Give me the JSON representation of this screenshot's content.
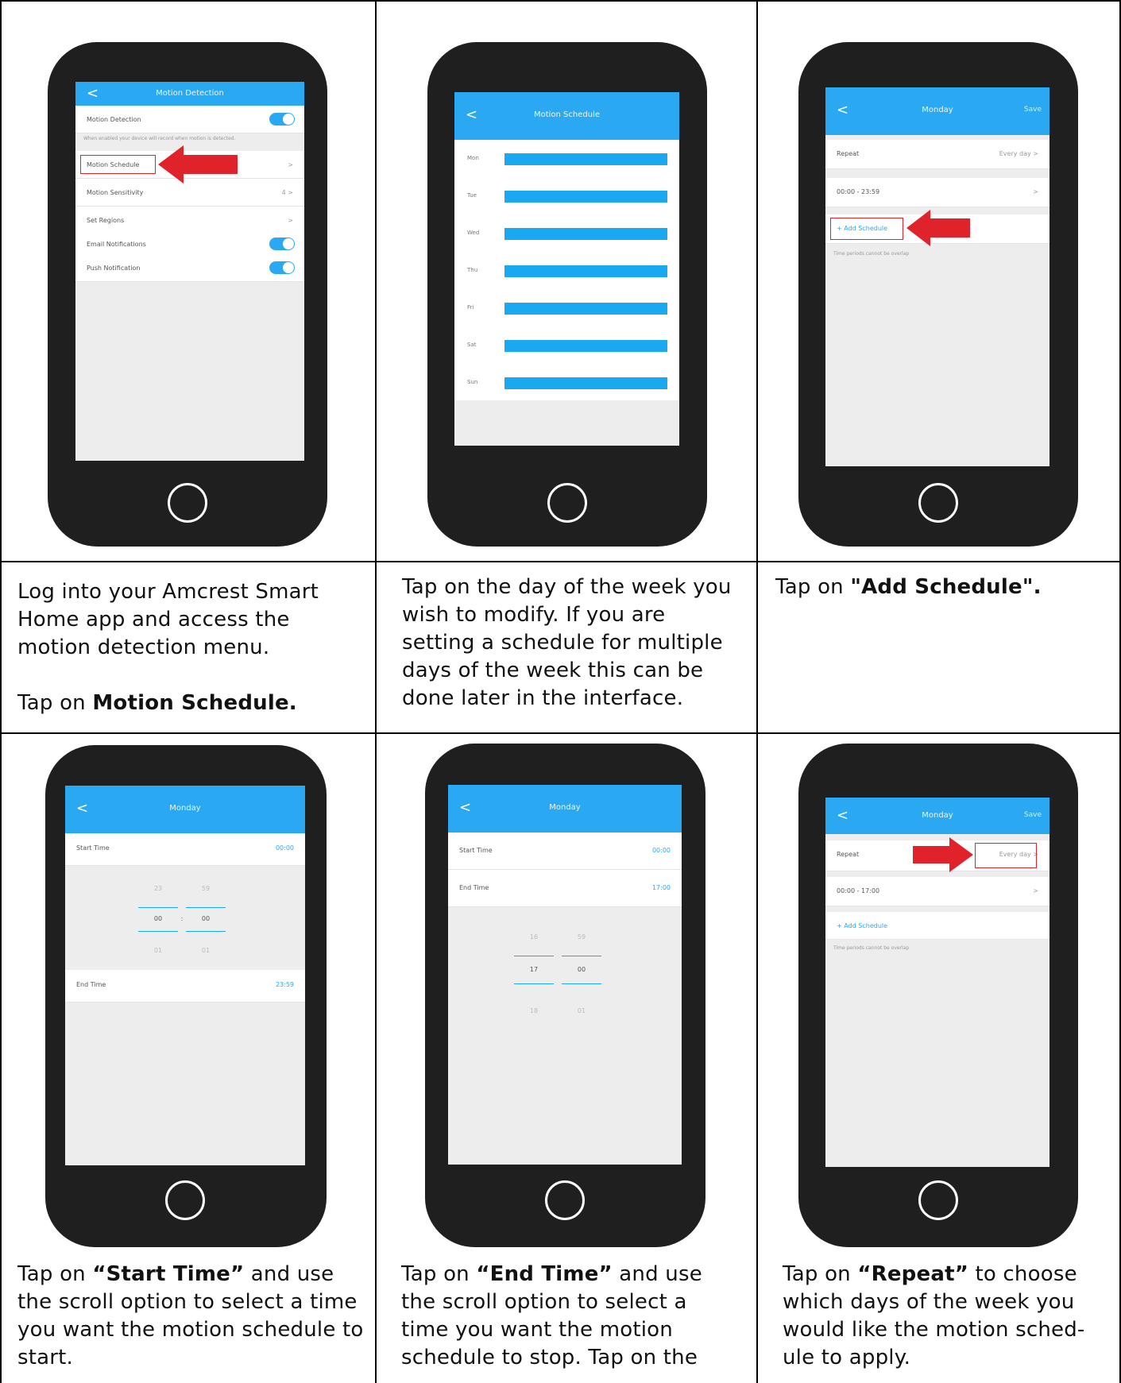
{
  "colors": {
    "accent": "#2aa9f2",
    "arrow": "#e0232b",
    "phone": "#1f1f1f"
  },
  "captions": {
    "c1_p1": "Log into your Amcrest Smart Home app and access the motion detection menu.",
    "c1_p2_pre": "Tap on ",
    "c1_p2_bold": "Motion Schedule.",
    "c2": "Tap on the day of the week you wish to modify. If you are setting a schedule for multiple days of the week this can be done later in the interface.",
    "c3_pre": "Tap on ",
    "c3_bold": "\"Add Schedule\".",
    "c4_pre": "Tap on ",
    "c4_bold": "“Start Time”",
    "c4_post": " and use the scroll option to select a time you want the motion schedule to start.",
    "c5_pre": "Tap on ",
    "c5_bold": "“End Time”",
    "c5_post": " and use the scroll option to select a time you want the motion schedule to stop. Tap on the",
    "c6_pre": "Tap on ",
    "c6_bold": "“Repeat”",
    "c6_post": " to choose which days of the week you would like the motion sched-ule to apply."
  },
  "phone1": {
    "title": "Motion Detection",
    "back": "<",
    "rows": {
      "motion_detection": "Motion Detection",
      "note": "When enabled your device will record when motion is detected.",
      "motion_schedule": "Motion Schedule",
      "motion_sensitivity": "Motion Sensitivity",
      "sensitivity_val": "4 >",
      "set_regions": "Set Regions",
      "chev": ">",
      "email": "Email Notifications",
      "push": "Push Notification"
    }
  },
  "phone2": {
    "title": "Motion Schedule",
    "back": "<",
    "days": [
      "Mon",
      "Tue",
      "Wed",
      "Thu",
      "Fri",
      "Sat",
      "Sun"
    ]
  },
  "phone3": {
    "title": "Monday",
    "back": "<",
    "action": "Save",
    "repeat": "Repeat",
    "repeat_val": "Every day  >",
    "range": "00:00 - 23:59",
    "chev": ">",
    "add": "+  Add Schedule",
    "note": "Time periods cannot be overlap"
  },
  "phone4": {
    "title": "Monday",
    "back": "<",
    "start": "Start Time",
    "start_val": "00:00",
    "end": "End Time",
    "end_val": "23:59",
    "wheel_h": [
      "23",
      "00",
      "01"
    ],
    "wheel_m": [
      "59",
      "00",
      "01"
    ],
    "colon": ":"
  },
  "phone5": {
    "title": "Monday",
    "back": "<",
    "start": "Start Time",
    "start_val": "00:00",
    "end": "End Time",
    "end_val": "17:00",
    "wheel_h": [
      "16",
      "17",
      "18"
    ],
    "wheel_m": [
      "59",
      "00",
      "01"
    ]
  },
  "phone6": {
    "title": "Monday",
    "back": "<",
    "action": "Save",
    "repeat": "Repeat",
    "repeat_val": "Every day  >",
    "range": "00:00 - 17:00",
    "chev": ">",
    "add": "+  Add Schedule",
    "note": "Time periods cannot be overlap"
  }
}
